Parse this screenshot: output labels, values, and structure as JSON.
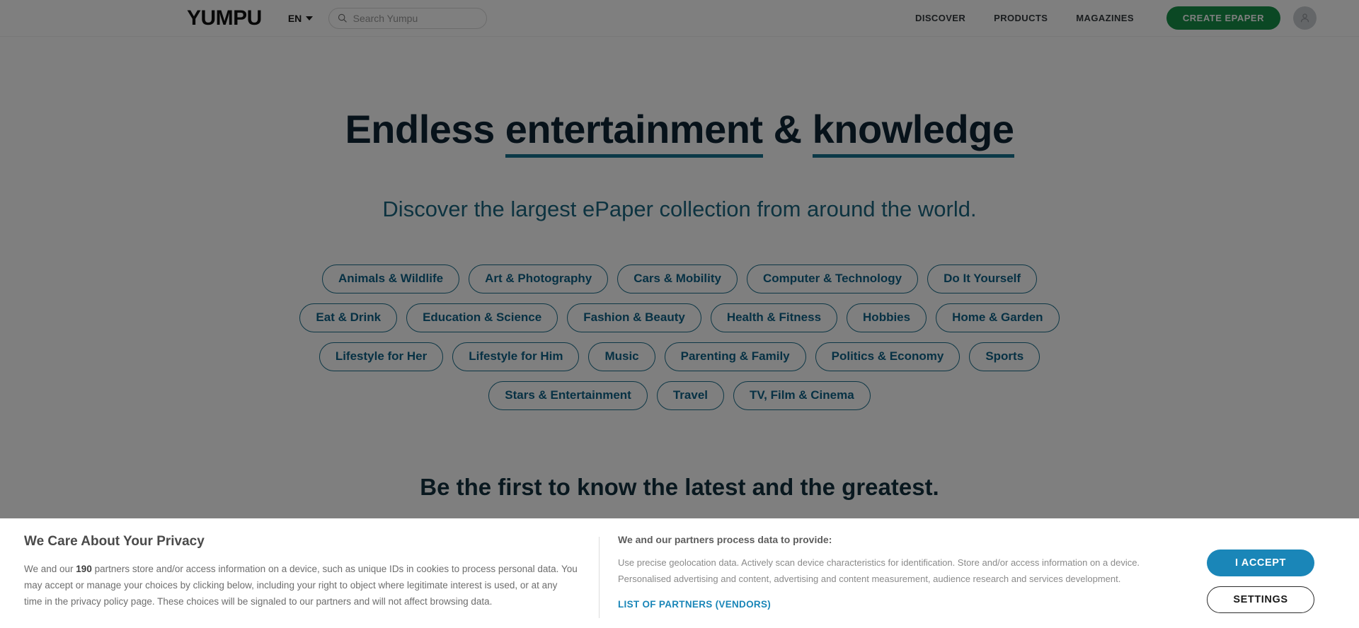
{
  "header": {
    "brand": "YUMPU",
    "language": "EN",
    "language_caret_icon": "chevron-down-icon",
    "search": {
      "placeholder": "Search Yumpu",
      "value": "",
      "icon": "search-icon"
    },
    "nav": [
      {
        "label": "DISCOVER"
      },
      {
        "label": "PRODUCTS"
      },
      {
        "label": "MAGAZINES"
      }
    ],
    "cta": {
      "label": "CREATE EPAPER",
      "color": "#179048"
    },
    "account_icon": "user-avatar-icon"
  },
  "hero": {
    "heading_part1": "Endless ",
    "heading_underline1": "entertainment",
    "heading_part2": " & ",
    "heading_underline2": "knowledge",
    "subheading": "Discover the largest ePaper collection from around the world.",
    "underline_color": "#17728f",
    "heading_color": "#0e2535",
    "subheading_color": "#1b6680"
  },
  "categories": {
    "accent_color": "#0f6288",
    "items": [
      {
        "label": "Animals & Wildlife"
      },
      {
        "label": "Art & Photography"
      },
      {
        "label": "Cars & Mobility"
      },
      {
        "label": "Computer & Technology"
      },
      {
        "label": "Do It Yourself"
      },
      {
        "label": "Eat & Drink"
      },
      {
        "label": "Education & Science"
      },
      {
        "label": "Fashion & Beauty"
      },
      {
        "label": "Health & Fitness"
      },
      {
        "label": "Hobbies"
      },
      {
        "label": "Home & Garden"
      },
      {
        "label": "Lifestyle for Her"
      },
      {
        "label": "Lifestyle for Him"
      },
      {
        "label": "Music"
      },
      {
        "label": "Parenting & Family"
      },
      {
        "label": "Politics & Economy"
      },
      {
        "label": "Sports"
      },
      {
        "label": "Stars & Entertainment"
      },
      {
        "label": "Travel"
      },
      {
        "label": "TV, Film & Cinema"
      }
    ]
  },
  "teaser": {
    "heading": "Be the first to know the latest and the greatest."
  },
  "consent": {
    "title": "We Care About Your Privacy",
    "partner_count": "190",
    "body_before_count": "We and our ",
    "body_after_count": " partners store and/or access information on a device, such as unique IDs in cookies to process personal data. You may accept or manage your choices by clicking below, including your right to object where legitimate interest is used, or at any time in the privacy policy page. These choices will be signaled to our partners and will not affect browsing data.",
    "purposes_title": "We and our partners process data to provide:",
    "purposes_body": "Use precise geolocation data. Actively scan device characteristics for identification. Store and/or access information on a device. Personalised advertising and content, advertising and content measurement, audience research and services development.",
    "vendors_link": "LIST OF PARTNERS (VENDORS)",
    "accept_label": "I ACCEPT",
    "settings_label": "SETTINGS",
    "accept_color": "#1a86b8",
    "link_color": "#1a86b8"
  }
}
